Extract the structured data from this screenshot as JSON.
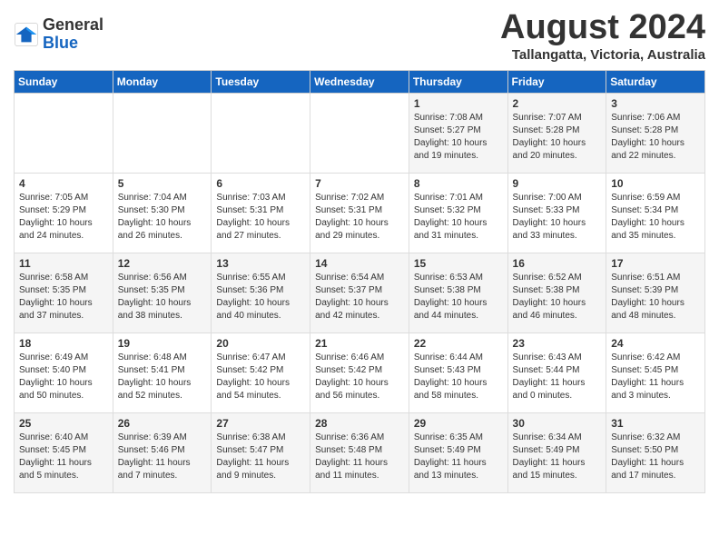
{
  "header": {
    "logo_line1": "General",
    "logo_line2": "Blue",
    "month_title": "August 2024",
    "location": "Tallangatta, Victoria, Australia"
  },
  "days_of_week": [
    "Sunday",
    "Monday",
    "Tuesday",
    "Wednesday",
    "Thursday",
    "Friday",
    "Saturday"
  ],
  "weeks": [
    [
      {
        "day": "",
        "info": ""
      },
      {
        "day": "",
        "info": ""
      },
      {
        "day": "",
        "info": ""
      },
      {
        "day": "",
        "info": ""
      },
      {
        "day": "1",
        "info": "Sunrise: 7:08 AM\nSunset: 5:27 PM\nDaylight: 10 hours\nand 19 minutes."
      },
      {
        "day": "2",
        "info": "Sunrise: 7:07 AM\nSunset: 5:28 PM\nDaylight: 10 hours\nand 20 minutes."
      },
      {
        "day": "3",
        "info": "Sunrise: 7:06 AM\nSunset: 5:28 PM\nDaylight: 10 hours\nand 22 minutes."
      }
    ],
    [
      {
        "day": "4",
        "info": "Sunrise: 7:05 AM\nSunset: 5:29 PM\nDaylight: 10 hours\nand 24 minutes."
      },
      {
        "day": "5",
        "info": "Sunrise: 7:04 AM\nSunset: 5:30 PM\nDaylight: 10 hours\nand 26 minutes."
      },
      {
        "day": "6",
        "info": "Sunrise: 7:03 AM\nSunset: 5:31 PM\nDaylight: 10 hours\nand 27 minutes."
      },
      {
        "day": "7",
        "info": "Sunrise: 7:02 AM\nSunset: 5:31 PM\nDaylight: 10 hours\nand 29 minutes."
      },
      {
        "day": "8",
        "info": "Sunrise: 7:01 AM\nSunset: 5:32 PM\nDaylight: 10 hours\nand 31 minutes."
      },
      {
        "day": "9",
        "info": "Sunrise: 7:00 AM\nSunset: 5:33 PM\nDaylight: 10 hours\nand 33 minutes."
      },
      {
        "day": "10",
        "info": "Sunrise: 6:59 AM\nSunset: 5:34 PM\nDaylight: 10 hours\nand 35 minutes."
      }
    ],
    [
      {
        "day": "11",
        "info": "Sunrise: 6:58 AM\nSunset: 5:35 PM\nDaylight: 10 hours\nand 37 minutes."
      },
      {
        "day": "12",
        "info": "Sunrise: 6:56 AM\nSunset: 5:35 PM\nDaylight: 10 hours\nand 38 minutes."
      },
      {
        "day": "13",
        "info": "Sunrise: 6:55 AM\nSunset: 5:36 PM\nDaylight: 10 hours\nand 40 minutes."
      },
      {
        "day": "14",
        "info": "Sunrise: 6:54 AM\nSunset: 5:37 PM\nDaylight: 10 hours\nand 42 minutes."
      },
      {
        "day": "15",
        "info": "Sunrise: 6:53 AM\nSunset: 5:38 PM\nDaylight: 10 hours\nand 44 minutes."
      },
      {
        "day": "16",
        "info": "Sunrise: 6:52 AM\nSunset: 5:38 PM\nDaylight: 10 hours\nand 46 minutes."
      },
      {
        "day": "17",
        "info": "Sunrise: 6:51 AM\nSunset: 5:39 PM\nDaylight: 10 hours\nand 48 minutes."
      }
    ],
    [
      {
        "day": "18",
        "info": "Sunrise: 6:49 AM\nSunset: 5:40 PM\nDaylight: 10 hours\nand 50 minutes."
      },
      {
        "day": "19",
        "info": "Sunrise: 6:48 AM\nSunset: 5:41 PM\nDaylight: 10 hours\nand 52 minutes."
      },
      {
        "day": "20",
        "info": "Sunrise: 6:47 AM\nSunset: 5:42 PM\nDaylight: 10 hours\nand 54 minutes."
      },
      {
        "day": "21",
        "info": "Sunrise: 6:46 AM\nSunset: 5:42 PM\nDaylight: 10 hours\nand 56 minutes."
      },
      {
        "day": "22",
        "info": "Sunrise: 6:44 AM\nSunset: 5:43 PM\nDaylight: 10 hours\nand 58 minutes."
      },
      {
        "day": "23",
        "info": "Sunrise: 6:43 AM\nSunset: 5:44 PM\nDaylight: 11 hours\nand 0 minutes."
      },
      {
        "day": "24",
        "info": "Sunrise: 6:42 AM\nSunset: 5:45 PM\nDaylight: 11 hours\nand 3 minutes."
      }
    ],
    [
      {
        "day": "25",
        "info": "Sunrise: 6:40 AM\nSunset: 5:45 PM\nDaylight: 11 hours\nand 5 minutes."
      },
      {
        "day": "26",
        "info": "Sunrise: 6:39 AM\nSunset: 5:46 PM\nDaylight: 11 hours\nand 7 minutes."
      },
      {
        "day": "27",
        "info": "Sunrise: 6:38 AM\nSunset: 5:47 PM\nDaylight: 11 hours\nand 9 minutes."
      },
      {
        "day": "28",
        "info": "Sunrise: 6:36 AM\nSunset: 5:48 PM\nDaylight: 11 hours\nand 11 minutes."
      },
      {
        "day": "29",
        "info": "Sunrise: 6:35 AM\nSunset: 5:49 PM\nDaylight: 11 hours\nand 13 minutes."
      },
      {
        "day": "30",
        "info": "Sunrise: 6:34 AM\nSunset: 5:49 PM\nDaylight: 11 hours\nand 15 minutes."
      },
      {
        "day": "31",
        "info": "Sunrise: 6:32 AM\nSunset: 5:50 PM\nDaylight: 11 hours\nand 17 minutes."
      }
    ]
  ]
}
